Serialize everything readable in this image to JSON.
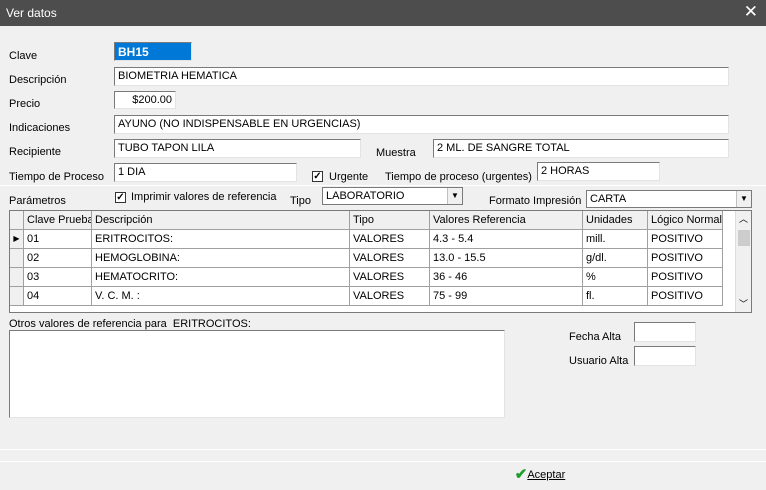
{
  "window": {
    "title": "Ver datos",
    "close_glyph": "✕"
  },
  "labels": {
    "clave": "Clave",
    "descripcion": "Descripción",
    "precio": "Precio",
    "indicaciones": "Indicaciones",
    "recipiente": "Recipiente",
    "muestra": "Muestra",
    "tiempo_proceso": "Tiempo de Proceso",
    "urgente": "Urgente",
    "tiempo_proceso_urgentes": "Tiempo de proceso (urgentes)",
    "parametros": "Parámetros",
    "imprimir_valores": "Imprimir valores de referencia",
    "tipo": "Tipo",
    "formato_impresion": "Formato Impresión",
    "otros_valores": "Otros valores de referencia para",
    "fecha_alta": "Fecha Alta",
    "usuario_alta": "Usuario Alta"
  },
  "values": {
    "clave": "BH15",
    "descripcion": "BIOMETRIA HEMATICA",
    "precio": "$200.00",
    "indicaciones": "AYUNO (NO INDISPENSABLE EN URGENCIAS)",
    "recipiente": "TUBO TAPON LILA",
    "muestra": "2 ML. DE SANGRE TOTAL",
    "tiempo_proceso": "1 DIA",
    "urgente_checked": true,
    "tiempo_proceso_urgentes": "2 HORAS",
    "imprimir_checked": true,
    "tipo": "LABORATORIO",
    "formato_impresion": "CARTA",
    "otros_valores_para": "ERITROCITOS:",
    "otros_valores_text": "",
    "fecha_alta": "",
    "usuario_alta": ""
  },
  "grid": {
    "columns": [
      "Clave Prueba",
      "Descripción",
      "Tipo",
      "Valores Referencia",
      "Unidades",
      "Lógico Normal"
    ],
    "rows": [
      [
        "01",
        "ERITROCITOS:",
        "VALORES",
        "4.3 - 5.4",
        "mill.",
        "POSITIVO"
      ],
      [
        "02",
        "HEMOGLOBINA:",
        "VALORES",
        "13.0 - 15.5",
        "g/dl.",
        "POSITIVO"
      ],
      [
        "03",
        "HEMATOCRITO:",
        "VALORES",
        "36 - 46",
        "%",
        "POSITIVO"
      ],
      [
        "04",
        "V. C. M. :",
        "VALORES",
        "75 - 99",
        "fl.",
        "POSITIVO"
      ]
    ],
    "current_row_marker": "▶"
  },
  "footer": {
    "accept_label": "Aceptar",
    "accept_icon": "check-icon"
  },
  "colors": {
    "titlebar": "#4d4d4d",
    "selection": "#0078d7",
    "check_green": "#1e9e2e"
  }
}
